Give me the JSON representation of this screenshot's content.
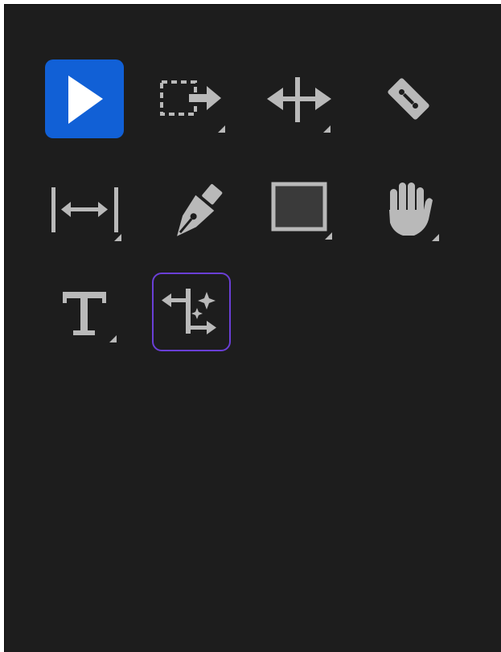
{
  "toolbar": {
    "accent_color": "#1160d6",
    "highlight_color": "#6a3fd6",
    "icon_color": "#b9b9b9",
    "background_color": "#1d1d1d",
    "tools": [
      {
        "id": "selection",
        "icon": "arrow-pointer-icon",
        "active": true,
        "has_flyout": false
      },
      {
        "id": "track-select-forward",
        "icon": "dashed-box-arrow-icon",
        "active": false,
        "has_flyout": true
      },
      {
        "id": "ripple-edit",
        "icon": "ripple-edit-icon",
        "active": false,
        "has_flyout": true
      },
      {
        "id": "razor",
        "icon": "razor-blade-icon",
        "active": false,
        "has_flyout": false
      },
      {
        "id": "slip",
        "icon": "slip-icon",
        "active": false,
        "has_flyout": true
      },
      {
        "id": "pen",
        "icon": "pen-nib-icon",
        "active": false,
        "has_flyout": false
      },
      {
        "id": "rectangle",
        "icon": "rectangle-icon",
        "active": false,
        "has_flyout": true
      },
      {
        "id": "hand",
        "icon": "hand-icon",
        "active": false,
        "has_flyout": true
      },
      {
        "id": "type",
        "icon": "type-t-icon",
        "active": false,
        "has_flyout": true
      },
      {
        "id": "generative-extend",
        "icon": "generative-extend-icon",
        "active": false,
        "highlighted": true,
        "has_flyout": false
      }
    ]
  }
}
